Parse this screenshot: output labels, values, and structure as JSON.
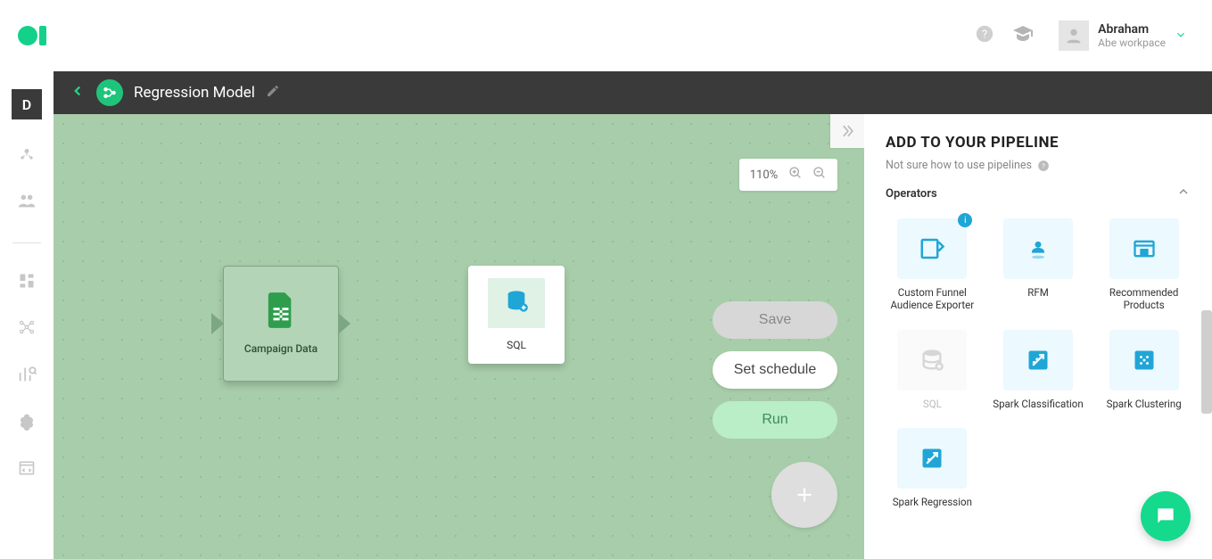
{
  "header": {
    "user_name": "Abraham",
    "workspace": "Abe workpace"
  },
  "left_badge": "D",
  "pipeline": {
    "title": "Regression Model"
  },
  "zoom": {
    "level": "110%"
  },
  "nodes": {
    "campaign": {
      "label": "Campaign Data"
    },
    "sql": {
      "label": "SQL"
    }
  },
  "actions": {
    "save": "Save",
    "schedule": "Set schedule",
    "run": "Run"
  },
  "right_panel": {
    "title": "ADD TO YOUR PIPELINE",
    "hint": "Not sure how to use pipelines",
    "section": "Operators",
    "operators": {
      "funnel": "Custom Funnel Audience Exporter",
      "rfm": "RFM",
      "recprod": "Recommended Products",
      "sql": "SQL",
      "sparkclass": "Spark Classification",
      "sparkcluster": "Spark Clustering",
      "sparkreg": "Spark Regression"
    }
  }
}
